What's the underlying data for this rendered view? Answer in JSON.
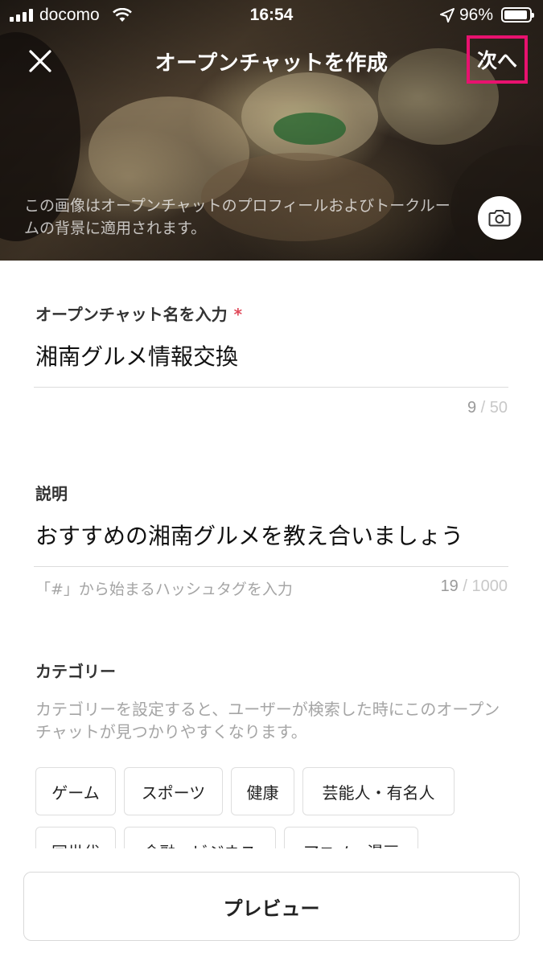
{
  "status_bar": {
    "carrier": "docomo",
    "time": "16:54",
    "battery": "96%"
  },
  "nav": {
    "title": "オープンチャットを作成",
    "next_label": "次へ",
    "highlight_color": "#e8126f"
  },
  "hero": {
    "caption": "この画像はオープンチャットのプロフィールおよびトークルームの背景に適用されます。"
  },
  "name_field": {
    "label": "オープンチャット名を入力",
    "required_mark": "*",
    "value": "湘南グルメ情報交換",
    "count": "9",
    "separator": "/",
    "max": "50"
  },
  "description_field": {
    "label": "説明",
    "value": "おすすめの湘南グルメを教え合いましょう",
    "hint": "「#」から始まるハッシュタグを入力",
    "count": "19",
    "separator": "/",
    "max": "1000"
  },
  "category": {
    "label": "カテゴリー",
    "description": "カテゴリーを設定すると、ユーザーが検索した時にこのオープンチャットが見つかりやすくなります。",
    "chips": [
      "ゲーム",
      "スポーツ",
      "健康",
      "芸能人・有名人",
      "同世代",
      "金融・ビジネス",
      "アニメ・漫画"
    ]
  },
  "footer": {
    "preview_label": "プレビュー"
  }
}
